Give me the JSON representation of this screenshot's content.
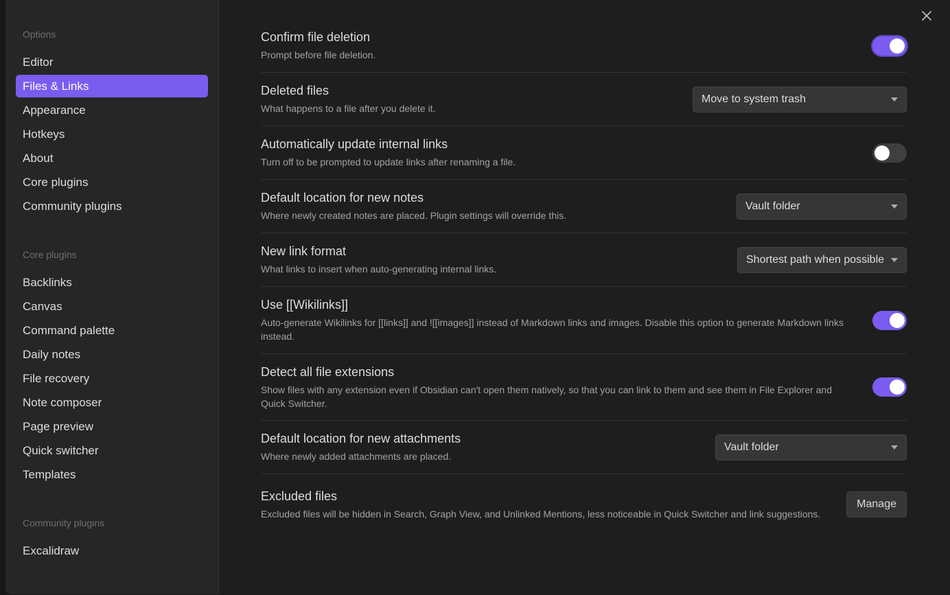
{
  "sidebar": {
    "options_heading": "Options",
    "options_items": [
      {
        "label": "Editor"
      },
      {
        "label": "Files & Links"
      },
      {
        "label": "Appearance"
      },
      {
        "label": "Hotkeys"
      },
      {
        "label": "About"
      },
      {
        "label": "Core plugins"
      },
      {
        "label": "Community plugins"
      }
    ],
    "core_heading": "Core plugins",
    "core_items": [
      {
        "label": "Backlinks"
      },
      {
        "label": "Canvas"
      },
      {
        "label": "Command palette"
      },
      {
        "label": "Daily notes"
      },
      {
        "label": "File recovery"
      },
      {
        "label": "Note composer"
      },
      {
        "label": "Page preview"
      },
      {
        "label": "Quick switcher"
      },
      {
        "label": "Templates"
      }
    ],
    "community_heading": "Community plugins",
    "community_items": [
      {
        "label": "Excalidraw"
      }
    ]
  },
  "close_icon": "close-icon",
  "settings": [
    {
      "name": "Confirm file deletion",
      "desc": "Prompt before file deletion.",
      "control": "toggle",
      "on": true
    },
    {
      "name": "Deleted files",
      "desc": "What happens to a file after you delete it.",
      "control": "dropdown",
      "value": "Move to system trash"
    },
    {
      "name": "Automatically update internal links",
      "desc": "Turn off to be prompted to update links after renaming a file.",
      "control": "toggle",
      "on": false
    },
    {
      "name": "Default location for new notes",
      "desc": "Where newly created notes are placed. Plugin settings will override this.",
      "control": "dropdown",
      "value": "Vault folder"
    },
    {
      "name": "New link format",
      "desc": "What links to insert when auto-generating internal links.",
      "control": "dropdown",
      "value": "Shortest path when possible"
    },
    {
      "name": "Use [[Wikilinks]]",
      "desc": "Auto-generate Wikilinks for [[links]] and ![[images]] instead of Markdown links and images. Disable this option to generate Markdown links instead.",
      "control": "toggle",
      "on": true
    },
    {
      "name": "Detect all file extensions",
      "desc": "Show files with any extension even if Obsidian can't open them natively, so that you can link to them and see them in File Explorer and Quick Switcher.",
      "control": "toggle",
      "on": true
    },
    {
      "name": "Default location for new attachments",
      "desc": "Where newly added attachments are placed.",
      "control": "dropdown",
      "value": "Vault folder"
    },
    {
      "name": "Excluded files",
      "desc": "Excluded files will be hidden in Search, Graph View, and Unlinked Mentions, less noticeable in Quick Switcher and link suggestions.",
      "control": "button",
      "value": "Manage"
    }
  ],
  "colors": {
    "accent": "#7b5cf0",
    "background": "#1e1e1e",
    "sidebar": "#262626"
  }
}
